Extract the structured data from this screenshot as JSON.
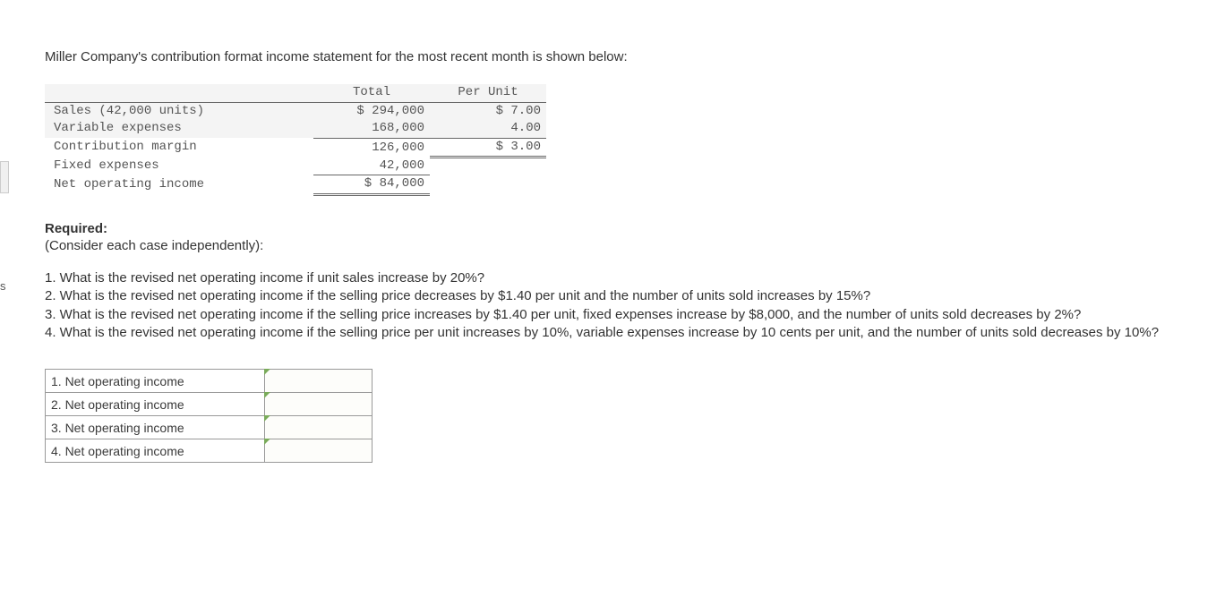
{
  "sidebar_char": "s",
  "intro": "Miller Company's contribution format income statement for the most recent month is shown below:",
  "income_statement": {
    "header_total": "Total",
    "header_per_unit": "Per Unit",
    "rows": [
      {
        "label": "Sales (42,000 units)",
        "total": "$ 294,000",
        "per_unit": "$ 7.00"
      },
      {
        "label": "Variable expenses",
        "total": "168,000",
        "per_unit": "4.00"
      },
      {
        "label": "Contribution margin",
        "total": "126,000",
        "per_unit": "$ 3.00"
      },
      {
        "label": "Fixed expenses",
        "total": "42,000",
        "per_unit": ""
      },
      {
        "label": "Net operating income",
        "total": "$ 84,000",
        "per_unit": ""
      }
    ]
  },
  "required_header": "Required:",
  "required_sub": "(Consider each case independently):",
  "questions": {
    "q1": "1. What is the revised net operating income if unit sales increase by 20%?",
    "q2": "2. What is the revised net operating income if the selling price decreases by $1.40 per unit and the number of units sold increases by 15%?",
    "q3": "3. What is the revised net operating income if the selling price increases by $1.40 per unit, fixed expenses increase by $8,000, and the number of units sold decreases by 2%?",
    "q4": "4. What is the revised net operating income if the selling price per unit increases by 10%, variable expenses increase by 10 cents per unit, and the number of units sold decreases by 10%?"
  },
  "answer_rows": [
    {
      "label": "1. Net operating income",
      "value": ""
    },
    {
      "label": "2. Net operating income",
      "value": ""
    },
    {
      "label": "3. Net operating income",
      "value": ""
    },
    {
      "label": "4. Net operating income",
      "value": ""
    }
  ]
}
